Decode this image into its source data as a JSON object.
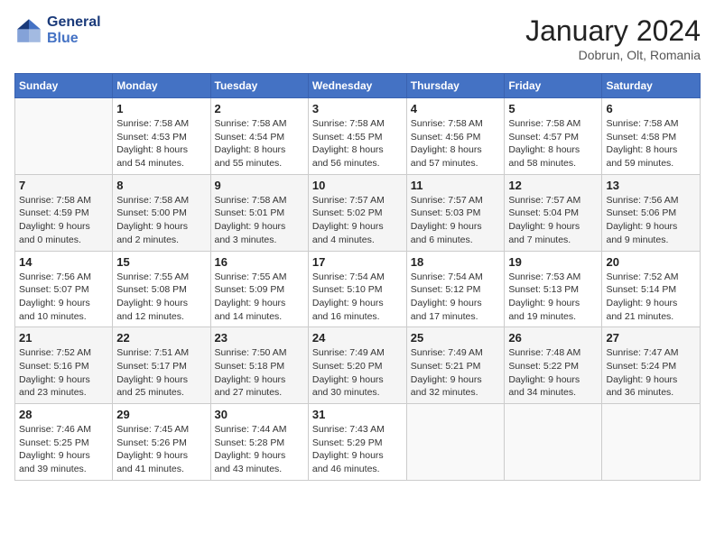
{
  "header": {
    "logo_line1": "General",
    "logo_line2": "Blue",
    "month": "January 2024",
    "location": "Dobrun, Olt, Romania"
  },
  "weekdays": [
    "Sunday",
    "Monday",
    "Tuesday",
    "Wednesday",
    "Thursday",
    "Friday",
    "Saturday"
  ],
  "weeks": [
    [
      {
        "day": "",
        "info": ""
      },
      {
        "day": "1",
        "info": "Sunrise: 7:58 AM\nSunset: 4:53 PM\nDaylight: 8 hours\nand 54 minutes."
      },
      {
        "day": "2",
        "info": "Sunrise: 7:58 AM\nSunset: 4:54 PM\nDaylight: 8 hours\nand 55 minutes."
      },
      {
        "day": "3",
        "info": "Sunrise: 7:58 AM\nSunset: 4:55 PM\nDaylight: 8 hours\nand 56 minutes."
      },
      {
        "day": "4",
        "info": "Sunrise: 7:58 AM\nSunset: 4:56 PM\nDaylight: 8 hours\nand 57 minutes."
      },
      {
        "day": "5",
        "info": "Sunrise: 7:58 AM\nSunset: 4:57 PM\nDaylight: 8 hours\nand 58 minutes."
      },
      {
        "day": "6",
        "info": "Sunrise: 7:58 AM\nSunset: 4:58 PM\nDaylight: 8 hours\nand 59 minutes."
      }
    ],
    [
      {
        "day": "7",
        "info": "Sunrise: 7:58 AM\nSunset: 4:59 PM\nDaylight: 9 hours\nand 0 minutes."
      },
      {
        "day": "8",
        "info": "Sunrise: 7:58 AM\nSunset: 5:00 PM\nDaylight: 9 hours\nand 2 minutes."
      },
      {
        "day": "9",
        "info": "Sunrise: 7:58 AM\nSunset: 5:01 PM\nDaylight: 9 hours\nand 3 minutes."
      },
      {
        "day": "10",
        "info": "Sunrise: 7:57 AM\nSunset: 5:02 PM\nDaylight: 9 hours\nand 4 minutes."
      },
      {
        "day": "11",
        "info": "Sunrise: 7:57 AM\nSunset: 5:03 PM\nDaylight: 9 hours\nand 6 minutes."
      },
      {
        "day": "12",
        "info": "Sunrise: 7:57 AM\nSunset: 5:04 PM\nDaylight: 9 hours\nand 7 minutes."
      },
      {
        "day": "13",
        "info": "Sunrise: 7:56 AM\nSunset: 5:06 PM\nDaylight: 9 hours\nand 9 minutes."
      }
    ],
    [
      {
        "day": "14",
        "info": "Sunrise: 7:56 AM\nSunset: 5:07 PM\nDaylight: 9 hours\nand 10 minutes."
      },
      {
        "day": "15",
        "info": "Sunrise: 7:55 AM\nSunset: 5:08 PM\nDaylight: 9 hours\nand 12 minutes."
      },
      {
        "day": "16",
        "info": "Sunrise: 7:55 AM\nSunset: 5:09 PM\nDaylight: 9 hours\nand 14 minutes."
      },
      {
        "day": "17",
        "info": "Sunrise: 7:54 AM\nSunset: 5:10 PM\nDaylight: 9 hours\nand 16 minutes."
      },
      {
        "day": "18",
        "info": "Sunrise: 7:54 AM\nSunset: 5:12 PM\nDaylight: 9 hours\nand 17 minutes."
      },
      {
        "day": "19",
        "info": "Sunrise: 7:53 AM\nSunset: 5:13 PM\nDaylight: 9 hours\nand 19 minutes."
      },
      {
        "day": "20",
        "info": "Sunrise: 7:52 AM\nSunset: 5:14 PM\nDaylight: 9 hours\nand 21 minutes."
      }
    ],
    [
      {
        "day": "21",
        "info": "Sunrise: 7:52 AM\nSunset: 5:16 PM\nDaylight: 9 hours\nand 23 minutes."
      },
      {
        "day": "22",
        "info": "Sunrise: 7:51 AM\nSunset: 5:17 PM\nDaylight: 9 hours\nand 25 minutes."
      },
      {
        "day": "23",
        "info": "Sunrise: 7:50 AM\nSunset: 5:18 PM\nDaylight: 9 hours\nand 27 minutes."
      },
      {
        "day": "24",
        "info": "Sunrise: 7:49 AM\nSunset: 5:20 PM\nDaylight: 9 hours\nand 30 minutes."
      },
      {
        "day": "25",
        "info": "Sunrise: 7:49 AM\nSunset: 5:21 PM\nDaylight: 9 hours\nand 32 minutes."
      },
      {
        "day": "26",
        "info": "Sunrise: 7:48 AM\nSunset: 5:22 PM\nDaylight: 9 hours\nand 34 minutes."
      },
      {
        "day": "27",
        "info": "Sunrise: 7:47 AM\nSunset: 5:24 PM\nDaylight: 9 hours\nand 36 minutes."
      }
    ],
    [
      {
        "day": "28",
        "info": "Sunrise: 7:46 AM\nSunset: 5:25 PM\nDaylight: 9 hours\nand 39 minutes."
      },
      {
        "day": "29",
        "info": "Sunrise: 7:45 AM\nSunset: 5:26 PM\nDaylight: 9 hours\nand 41 minutes."
      },
      {
        "day": "30",
        "info": "Sunrise: 7:44 AM\nSunset: 5:28 PM\nDaylight: 9 hours\nand 43 minutes."
      },
      {
        "day": "31",
        "info": "Sunrise: 7:43 AM\nSunset: 5:29 PM\nDaylight: 9 hours\nand 46 minutes."
      },
      {
        "day": "",
        "info": ""
      },
      {
        "day": "",
        "info": ""
      },
      {
        "day": "",
        "info": ""
      }
    ]
  ]
}
